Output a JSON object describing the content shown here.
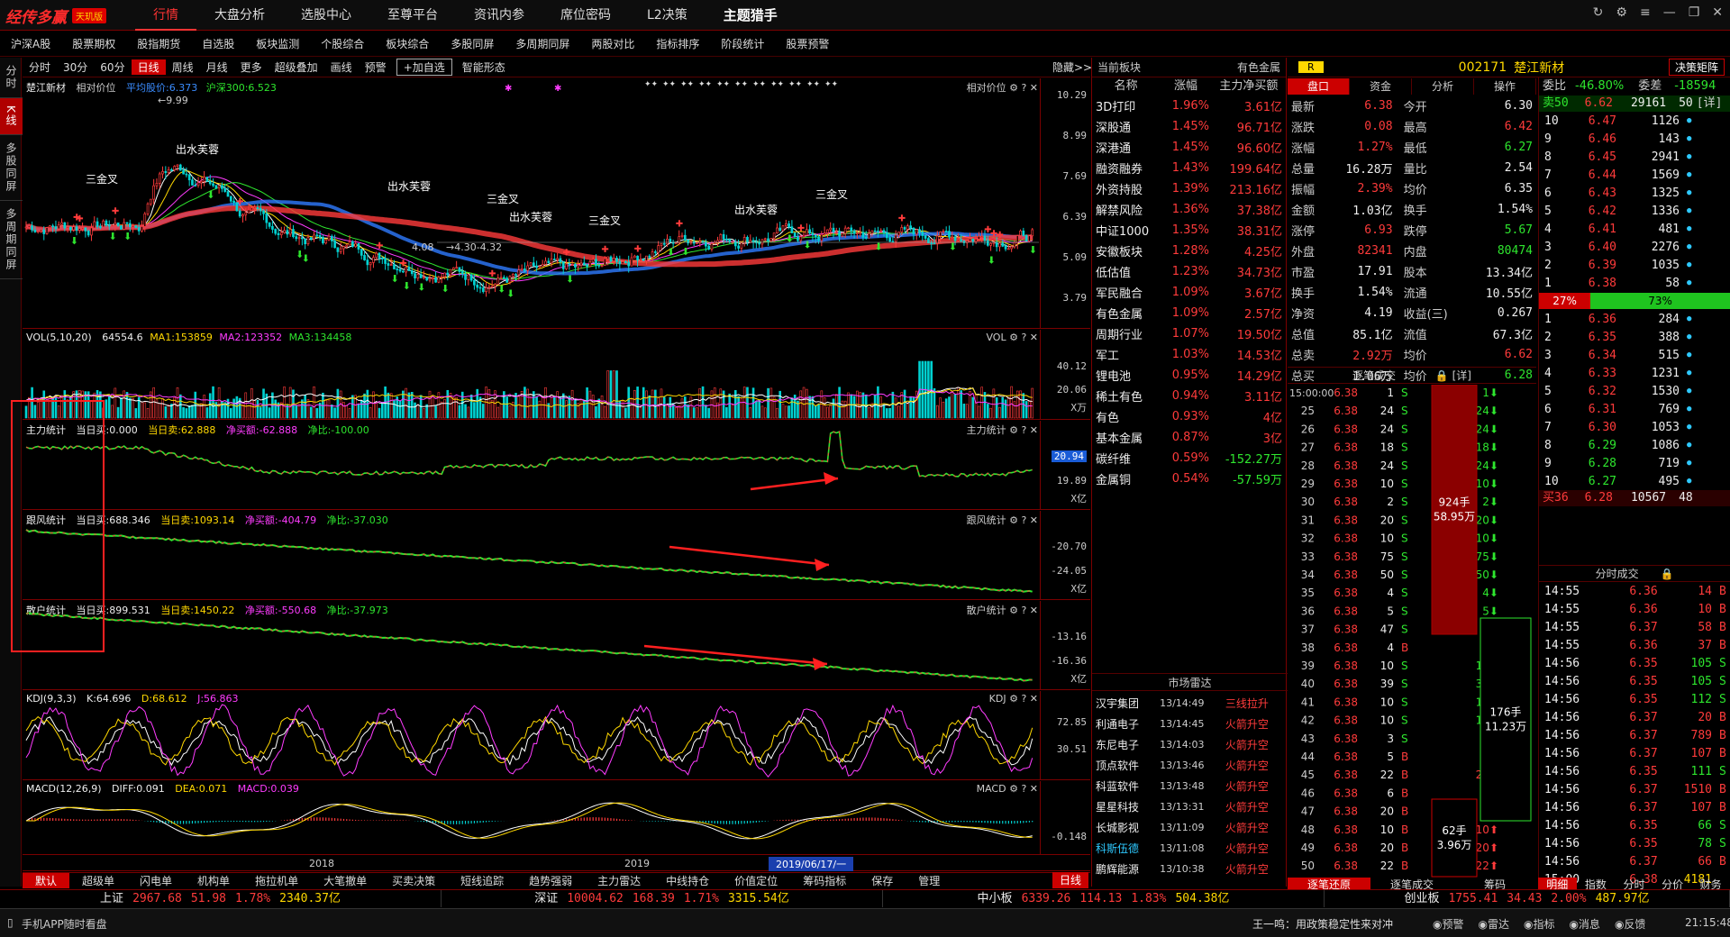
{
  "app": {
    "logo_mark": "经传多赢",
    "edition": "天玑版"
  },
  "menu": [
    "行情",
    "大盘分析",
    "选股中心",
    "至尊平台",
    "资讯内参",
    "席位密码",
    "L2决策",
    "主题猎手"
  ],
  "submenu": [
    "沪深A股",
    "股票期权",
    "股指期货",
    "自选股",
    "板块监测",
    "个股综合",
    "板块综合",
    "多股同屏",
    "多周期同屏",
    "两股对比",
    "指标排序",
    "阶段统计",
    "股票预警"
  ],
  "sidebar": [
    "分时",
    "K线",
    "多股同屏",
    "多周期同屏"
  ],
  "chart_toolbar": [
    "分时",
    "30分",
    "60分",
    "日线",
    "周线",
    "月线",
    "更多",
    "超级叠加",
    "画线",
    "预警",
    "+加自选",
    "智能形态"
  ],
  "chart_toolbar_hide": "隐藏>>",
  "kline": {
    "name": "楚江新材",
    "mode": "相对价位",
    "avg": "平均股价:6.373",
    "hs300": "沪深300:6.523",
    "label_right": "相对价位",
    "yticks": [
      "10.29",
      "8.99",
      "7.69",
      "6.39",
      "5.09",
      "3.79"
    ],
    "hi": "9.99",
    "lo": "4.08",
    "range": "4.30-4.32",
    "signals": [
      "三金叉",
      "出水芙蓉",
      "三金叉",
      "出水芙蓉",
      "三金叉",
      "出水芙蓉",
      "出水芙蓉",
      "三金叉"
    ]
  },
  "vol": {
    "title": "VOL(5,10,20)",
    "v": "64554.6",
    "ma1": "MA1:153859",
    "ma2": "MA2:123352",
    "ma3": "MA3:134458",
    "yticks": [
      "40.12",
      "20.06",
      "X万"
    ],
    "right": "VOL"
  },
  "zl": {
    "title": "主力统计",
    "buy": "当日买:0.000",
    "sell": "当日卖:62.888",
    "net": "净买额:-62.888",
    "ratio": "净比:-100.00",
    "right": "主力统计",
    "yticks": [
      "20.94",
      "19.89",
      "X亿"
    ]
  },
  "gf": {
    "title": "跟风统计",
    "buy": "当日买:688.346",
    "sell": "当日卖:1093.14",
    "net": "净买额:-404.79",
    "ratio": "净比:-37.030",
    "right": "跟风统计",
    "yticks": [
      "-20.70",
      "-24.05",
      "X亿"
    ]
  },
  "sh": {
    "title": "散户统计",
    "buy": "当日买:899.531",
    "sell": "当日卖:1450.22",
    "net": "净买额:-550.68",
    "ratio": "净比:-37.973",
    "right": "散户统计",
    "yticks": [
      "-13.16",
      "-16.36",
      "X亿"
    ]
  },
  "kdj": {
    "title": "KDJ(9,3,3)",
    "k": "K:64.696",
    "d": "D:68.612",
    "j": "J:56.863",
    "right": "KDJ",
    "yticks": [
      "72.85",
      "30.51"
    ]
  },
  "macd": {
    "title": "MACD(12,26,9)",
    "diff": "DIFF:0.091",
    "dea": "DEA:0.071",
    "macd": "MACD:0.039",
    "right": "MACD",
    "yticks": [
      "-0.148"
    ]
  },
  "xaxis": [
    "2018",
    "2019",
    "2019/06/17/一"
  ],
  "bottom_tabs": [
    "默认",
    "超级单",
    "闪电单",
    "机构单",
    "拖拉机单",
    "大笔撤单",
    "买卖决策",
    "短线追踪",
    "趋势强弱",
    "主力雷达",
    "中线持仓",
    "价值定位",
    "筹码指标",
    "保存",
    "管理"
  ],
  "bottom_right": "日线",
  "sectors": {
    "h1": "当前板块",
    "h2": "有色金属",
    "cols": [
      "名称",
      "涨幅",
      "主力净买额"
    ],
    "rows": [
      [
        "3D打印",
        "1.96%",
        "3.61亿"
      ],
      [
        "深股通",
        "1.45%",
        "96.71亿"
      ],
      [
        "深港通",
        "1.45%",
        "96.60亿"
      ],
      [
        "融资融券",
        "1.43%",
        "199.64亿"
      ],
      [
        "外资持股",
        "1.39%",
        "213.16亿"
      ],
      [
        "解禁风险",
        "1.36%",
        "37.38亿"
      ],
      [
        "中证1000",
        "1.35%",
        "38.31亿"
      ],
      [
        "安徽板块",
        "1.28%",
        "4.25亿"
      ],
      [
        "低估值",
        "1.23%",
        "34.73亿"
      ],
      [
        "军民融合",
        "1.09%",
        "3.67亿"
      ],
      [
        "有色金属",
        "1.09%",
        "2.57亿"
      ],
      [
        "周期行业",
        "1.07%",
        "19.50亿"
      ],
      [
        "军工",
        "1.03%",
        "14.53亿"
      ],
      [
        "锂电池",
        "0.95%",
        "14.29亿"
      ],
      [
        "稀土有色",
        "0.94%",
        "3.11亿"
      ],
      [
        "有色",
        "0.93%",
        "4亿"
      ],
      [
        "基本金属",
        "0.87%",
        "3亿"
      ],
      [
        "碳纤维",
        "0.59%",
        "-152.27万"
      ],
      [
        "金属铜",
        "0.54%",
        "-57.59万"
      ]
    ]
  },
  "radar": {
    "title": "市场雷达",
    "rows": [
      [
        "汉宇集团",
        "13/14:49",
        "三线拉升"
      ],
      [
        "利通电子",
        "13/14:45",
        "火箭升空"
      ],
      [
        "东尼电子",
        "13/14:03",
        "火箭升空"
      ],
      [
        "顶点软件",
        "13/13:46",
        "火箭升空"
      ],
      [
        "科蓝软件",
        "13/13:48",
        "火箭升空"
      ],
      [
        "星星科技",
        "13/13:31",
        "火箭升空"
      ],
      [
        "长城影视",
        "13/11:09",
        "火箭升空"
      ],
      [
        "科斯伍德",
        "13/11:08",
        "火箭升空"
      ],
      [
        "鹏辉能源",
        "13/10:38",
        "火箭升空"
      ]
    ]
  },
  "stock": {
    "badge": "R",
    "code": "002171",
    "name": "楚江新材",
    "btn": "决策矩阵",
    "tabs": [
      "盘口",
      "资金",
      "分析",
      "操作"
    ],
    "quote": [
      [
        "最新",
        "6.38",
        "今开",
        "6.30"
      ],
      [
        "涨跌",
        "0.08",
        "最高",
        "6.42"
      ],
      [
        "涨幅",
        "1.27%",
        "最低",
        "6.27"
      ],
      [
        "总量",
        "16.28万",
        "量比",
        "2.54"
      ],
      [
        "振幅",
        "2.39%",
        "均价",
        "6.35"
      ],
      [
        "金额",
        "1.03亿",
        "换手",
        "1.54%"
      ],
      [
        "涨停",
        "6.93",
        "跌停",
        "5.67"
      ],
      [
        "外盘",
        "82341",
        "内盘",
        "80474"
      ],
      [
        "市盈",
        "17.91",
        "股本",
        "13.34亿"
      ],
      [
        "换手",
        "1.54%",
        "流通",
        "10.55亿"
      ],
      [
        "净资",
        "4.19",
        "收益(三)",
        "0.267"
      ],
      [
        "总值",
        "85.1亿",
        "流值",
        "67.3亿"
      ],
      [
        "总卖",
        "2.92万",
        "均价",
        "6.62"
      ],
      [
        "总买",
        "1.06万",
        "均价",
        "6.28"
      ]
    ]
  },
  "book": {
    "wb": "委比",
    "wbv": "-46.80%",
    "wc": "委差",
    "wcv": "-18594",
    "sell50": [
      "卖50",
      "6.62",
      "29161",
      "50",
      "[详]"
    ],
    "asks": [
      [
        "10",
        "6.47",
        "1126"
      ],
      [
        "9",
        "6.46",
        "143"
      ],
      [
        "8",
        "6.45",
        "2941"
      ],
      [
        "7",
        "6.44",
        "1569"
      ],
      [
        "6",
        "6.43",
        "1325"
      ],
      [
        "5",
        "6.42",
        "1336"
      ],
      [
        "4",
        "6.41",
        "481"
      ],
      [
        "3",
        "6.40",
        "2276"
      ],
      [
        "2",
        "6.39",
        "1035"
      ],
      [
        "1",
        "6.38",
        "58"
      ]
    ],
    "pct_sell": "27%",
    "pct_buy": "73%",
    "bids": [
      [
        "1",
        "6.36",
        "284"
      ],
      [
        "2",
        "6.35",
        "388"
      ],
      [
        "3",
        "6.34",
        "515"
      ],
      [
        "4",
        "6.33",
        "1231"
      ],
      [
        "5",
        "6.32",
        "1530"
      ],
      [
        "6",
        "6.31",
        "769"
      ],
      [
        "7",
        "6.30",
        "1053"
      ],
      [
        "8",
        "6.29",
        "1086"
      ],
      [
        "9",
        "6.28",
        "719"
      ],
      [
        "10",
        "6.27",
        "495"
      ]
    ],
    "buy36": [
      "买36",
      "6.28",
      "10567",
      "48"
    ]
  },
  "trades": {
    "title": "逐笔成交",
    "detail": "[详]",
    "t0": "15:00:00",
    "rows": [
      [
        "",
        "6.38",
        "1",
        "S",
        "1"
      ],
      [
        "25",
        "6.38",
        "24",
        "S",
        "24"
      ],
      [
        "26",
        "6.38",
        "24",
        "S",
        "24"
      ],
      [
        "27",
        "6.38",
        "18",
        "S",
        "18"
      ],
      [
        "28",
        "6.38",
        "24",
        "S",
        "24"
      ],
      [
        "29",
        "6.38",
        "10",
        "S",
        "10"
      ],
      [
        "30",
        "6.38",
        "2",
        "S",
        "2"
      ],
      [
        "31",
        "6.38",
        "20",
        "S",
        "20"
      ],
      [
        "32",
        "6.38",
        "10",
        "S",
        "10"
      ],
      [
        "33",
        "6.38",
        "75",
        "S",
        "75"
      ],
      [
        "34",
        "6.38",
        "50",
        "S",
        "50"
      ],
      [
        "35",
        "6.38",
        "4",
        "S",
        "4"
      ],
      [
        "36",
        "6.38",
        "5",
        "S",
        "5"
      ],
      [
        "37",
        "6.38",
        "47",
        "S",
        ""
      ],
      [
        "38",
        "6.38",
        "4",
        "B",
        "4"
      ],
      [
        "39",
        "6.38",
        "10",
        "S",
        "10"
      ],
      [
        "40",
        "6.38",
        "39",
        "S",
        "39"
      ],
      [
        "41",
        "6.38",
        "10",
        "S",
        "10"
      ],
      [
        "42",
        "6.38",
        "10",
        "S",
        "10"
      ],
      [
        "43",
        "6.38",
        "3",
        "S",
        "3"
      ],
      [
        "44",
        "6.38",
        "5",
        "B",
        "5"
      ],
      [
        "45",
        "6.38",
        "22",
        "B",
        "22"
      ],
      [
        "46",
        "6.38",
        "6",
        "B",
        "6"
      ],
      [
        "47",
        "6.38",
        "20",
        "B",
        ""
      ],
      [
        "48",
        "6.38",
        "10",
        "B",
        "10"
      ],
      [
        "49",
        "6.38",
        "20",
        "B",
        "20"
      ],
      [
        "50",
        "6.38",
        "22",
        "B",
        "22"
      ]
    ],
    "blk1a": "924手",
    "blk1b": "58.95万",
    "blk2a": "176手",
    "blk2b": "11.23万",
    "blk3a": "62手",
    "blk3b": "3.96万"
  },
  "ticks": {
    "title": "分时成交",
    "rows": [
      [
        "14:55",
        "6.36",
        "14",
        "B"
      ],
      [
        "14:55",
        "6.36",
        "10",
        "B"
      ],
      [
        "14:55",
        "6.37",
        "58",
        "B"
      ],
      [
        "14:55",
        "6.36",
        "37",
        "B"
      ],
      [
        "14:56",
        "6.35",
        "105",
        "S"
      ],
      [
        "14:56",
        "6.35",
        "105",
        "S"
      ],
      [
        "14:56",
        "6.35",
        "112",
        "S"
      ],
      [
        "14:56",
        "6.37",
        "20",
        "B"
      ],
      [
        "14:56",
        "6.37",
        "789",
        "B"
      ],
      [
        "14:56",
        "6.37",
        "107",
        "B"
      ],
      [
        "14:56",
        "6.35",
        "111",
        "S"
      ],
      [
        "14:56",
        "6.37",
        "1510",
        "B"
      ],
      [
        "14:56",
        "6.37",
        "107",
        "B"
      ],
      [
        "14:56",
        "6.35",
        "66",
        "S"
      ],
      [
        "14:56",
        "6.35",
        "78",
        "S"
      ],
      [
        "14:56",
        "6.37",
        "66",
        "B"
      ],
      [
        "15:00",
        "6.38",
        "4181",
        ""
      ]
    ]
  },
  "rbtabs": [
    "逐笔还原",
    "逐笔成交",
    "筹码"
  ],
  "rbtabs2": [
    "明细",
    "指数",
    "分时",
    "分价",
    "财务"
  ],
  "indices": [
    [
      "上证",
      "2967.68",
      "51.98",
      "1.78%",
      "2340.37亿"
    ],
    [
      "深证",
      "10004.62",
      "168.39",
      "1.71%",
      "3315.54亿"
    ],
    [
      "中小板",
      "6339.26",
      "114.13",
      "1.83%",
      "504.38亿"
    ],
    [
      "创业板",
      "1755.41",
      "34.43",
      "2.00%",
      "487.97亿"
    ]
  ],
  "statusbar": {
    "left": "手机APP随时看盘",
    "news": "王一鸣：用政策稳定性来对冲",
    "items": [
      "预警",
      "雷达",
      "指标",
      "消息",
      "反馈"
    ],
    "time": "21:15:48"
  }
}
